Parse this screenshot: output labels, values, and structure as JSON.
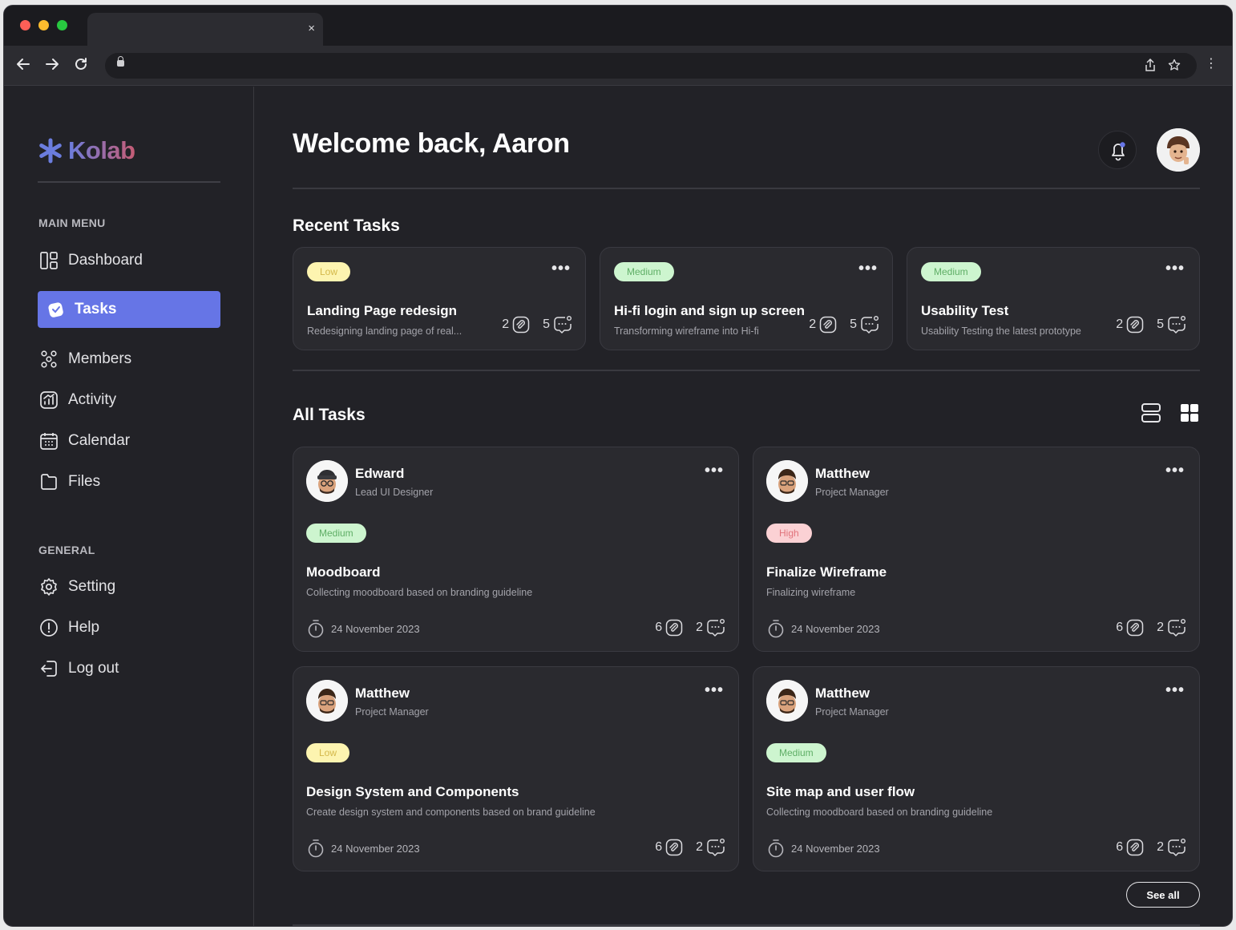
{
  "browser": {
    "tab_close": "×",
    "kebab": "⋮"
  },
  "brand": {
    "name": "Kolab"
  },
  "sidebar": {
    "main_menu_heading": "MAIN MENU",
    "main_items": [
      {
        "label": "Dashboard",
        "icon": "dashboard-icon"
      },
      {
        "label": "Tasks",
        "icon": "tasks-icon",
        "active": true
      },
      {
        "label": "Members",
        "icon": "members-icon"
      },
      {
        "label": "Activity",
        "icon": "activity-icon"
      },
      {
        "label": "Calendar",
        "icon": "calendar-icon"
      },
      {
        "label": "Files",
        "icon": "files-icon"
      }
    ],
    "general_heading": "GENERAL",
    "general_items": [
      {
        "label": "Setting",
        "icon": "gear-icon"
      },
      {
        "label": "Help",
        "icon": "help-icon"
      },
      {
        "label": "Log out",
        "icon": "logout-icon"
      }
    ]
  },
  "header": {
    "welcome": "Welcome back, Aaron"
  },
  "recent": {
    "title": "Recent Tasks",
    "tasks": [
      {
        "priority": "Low",
        "title": "Landing Page redesign",
        "subtitle": "Redesigning landing page of real...",
        "attachments": "2",
        "comments": "5"
      },
      {
        "priority": "Medium",
        "title": "Hi-fi login and sign up screen",
        "subtitle": "Transforming wireframe into Hi-fi",
        "attachments": "2",
        "comments": "5"
      },
      {
        "priority": "Medium",
        "title": "Usability Test",
        "subtitle": "Usability Testing the latest prototype",
        "attachments": "2",
        "comments": "5"
      }
    ]
  },
  "all": {
    "title": "All Tasks",
    "see_all": "See all",
    "tasks": [
      {
        "name": "Edward",
        "role": "Lead UI Designer",
        "priority": "Medium",
        "title": "Moodboard",
        "subtitle": "Collecting moodboard based on branding guideline",
        "date": "24 November 2023",
        "attachments": "6",
        "comments": "2"
      },
      {
        "name": "Matthew",
        "role": "Project Manager",
        "priority": "High",
        "title": "Finalize Wireframe",
        "subtitle": "Finalizing wireframe",
        "date": "24 November 2023",
        "attachments": "6",
        "comments": "2"
      },
      {
        "name": "Matthew",
        "role": "Project Manager",
        "priority": "Low",
        "title": "Design System and Components",
        "subtitle": "Create design system and components based on brand guideline",
        "date": "24 November 2023",
        "attachments": "6",
        "comments": "2"
      },
      {
        "name": "Matthew",
        "role": "Project Manager",
        "priority": "Medium",
        "title": "Site map and user flow",
        "subtitle": "Collecting moodboard based on branding guideline",
        "date": "24 November 2023",
        "attachments": "6",
        "comments": "2"
      }
    ]
  },
  "colors": {
    "accent": "#6675e6",
    "low": "#fdf4b0",
    "medium": "#cdf5cf",
    "high": "#fbd1d4",
    "background": "#222227"
  }
}
